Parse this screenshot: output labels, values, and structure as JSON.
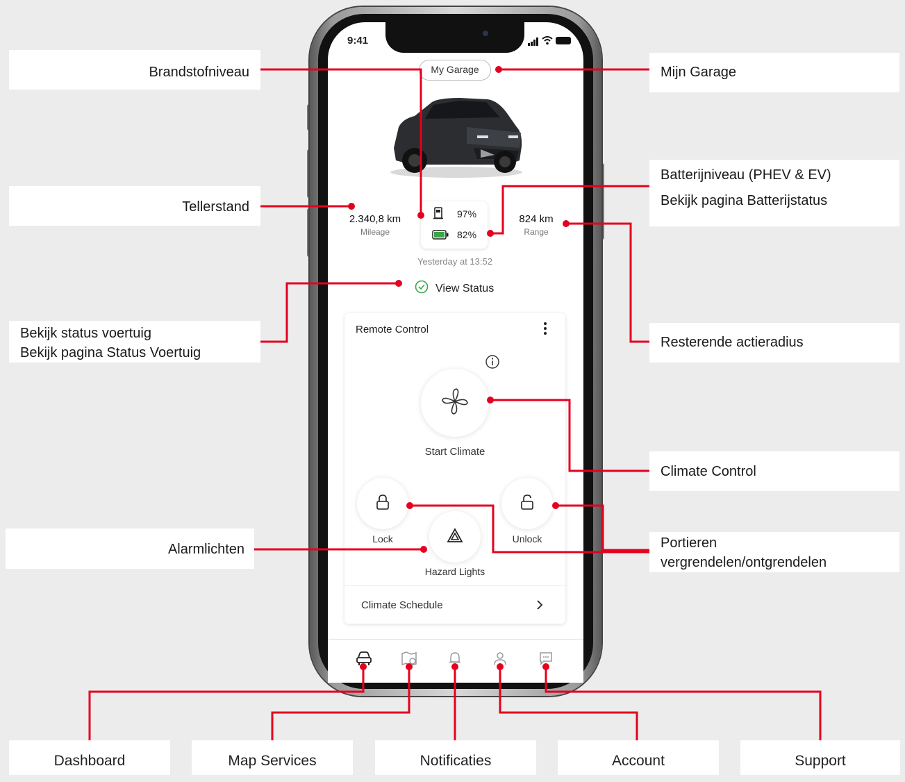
{
  "phone": {
    "status_time": "9:41",
    "garage_button": "My Garage",
    "mileage": {
      "value": "2.340,8 km",
      "label": "Mileage"
    },
    "fuel_percent": "97%",
    "battery_percent": "82%",
    "range": {
      "value": "824 km",
      "label": "Range"
    },
    "updated": "Yesterday at 13:52",
    "view_status": "View Status",
    "remote_control": {
      "title": "Remote Control",
      "start_climate": "Start Climate",
      "lock": "Lock",
      "unlock": "Unlock",
      "hazard": "Hazard Lights",
      "schedule": "Climate Schedule"
    }
  },
  "callouts": {
    "brandstof": "Brandstofniveau",
    "tellerstand": "Tellerstand",
    "status_1": "Bekijk status voertuig",
    "status_2": "Bekijk pagina Status Voertuig",
    "alarm": "Alarmlichten",
    "garage": "Mijn Garage",
    "battery_1": "Batterijniveau (PHEV & EV)",
    "battery_2": "Bekijk pagina Batterijstatus",
    "range": "Resterende actieradius",
    "climate": "Climate Control",
    "doors_1": "Portieren",
    "doors_2": "vergrendelen/ontgrendelen"
  },
  "bottom_labels": {
    "dashboard": "Dashboard",
    "map": "Map Services",
    "notifications": "Notificaties",
    "account": "Account",
    "support": "Support"
  },
  "colors": {
    "accent": "#e5001e",
    "ok_green": "#3aa64a"
  }
}
